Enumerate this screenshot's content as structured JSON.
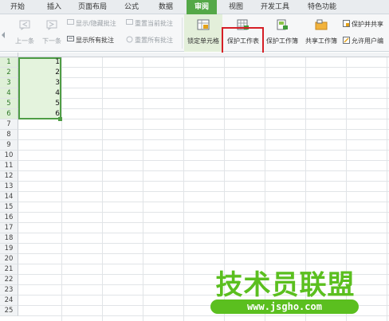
{
  "tabs": [
    {
      "label": "开始",
      "active": false
    },
    {
      "label": "插入",
      "active": false
    },
    {
      "label": "页面布局",
      "active": false
    },
    {
      "label": "公式",
      "active": false
    },
    {
      "label": "数据",
      "active": false
    },
    {
      "label": "审阅",
      "active": true
    },
    {
      "label": "视图",
      "active": false
    },
    {
      "label": "开发工具",
      "active": false
    },
    {
      "label": "特色功能",
      "active": false
    }
  ],
  "ribbon": {
    "prev_comment": "上一条",
    "next_comment": "下一条",
    "show_hide_comment": "显示/隐藏批注",
    "reset_current_comment": "重置当前批注",
    "show_all_comments": "显示所有批注",
    "reset_all_comments": "重置所有批注",
    "lock_cell": "锁定单元格",
    "protect_sheet": "保护工作表",
    "protect_workbook": "保护工作簿",
    "share_workbook": "共享工作簿",
    "protect_and_share": "保护并共享",
    "allow_users_edit": "允许用户编"
  },
  "grid": {
    "row_numbers": [
      "1",
      "2",
      "3",
      "4",
      "5",
      "6",
      "7",
      "8",
      "9",
      "10",
      "11",
      "12",
      "13",
      "14",
      "15",
      "16",
      "17",
      "18",
      "19",
      "20",
      "21",
      "22",
      "23",
      "24",
      "25"
    ],
    "selected_rows": 6,
    "cell_values": [
      "1",
      "2",
      "3",
      "4",
      "5",
      "6"
    ]
  },
  "watermark": {
    "title": "技术员联盟",
    "url": "www.jsgho.com"
  },
  "colors": {
    "accent": "#54a848",
    "highlight": "#d61f26",
    "watermark": "#5bbf1f"
  }
}
